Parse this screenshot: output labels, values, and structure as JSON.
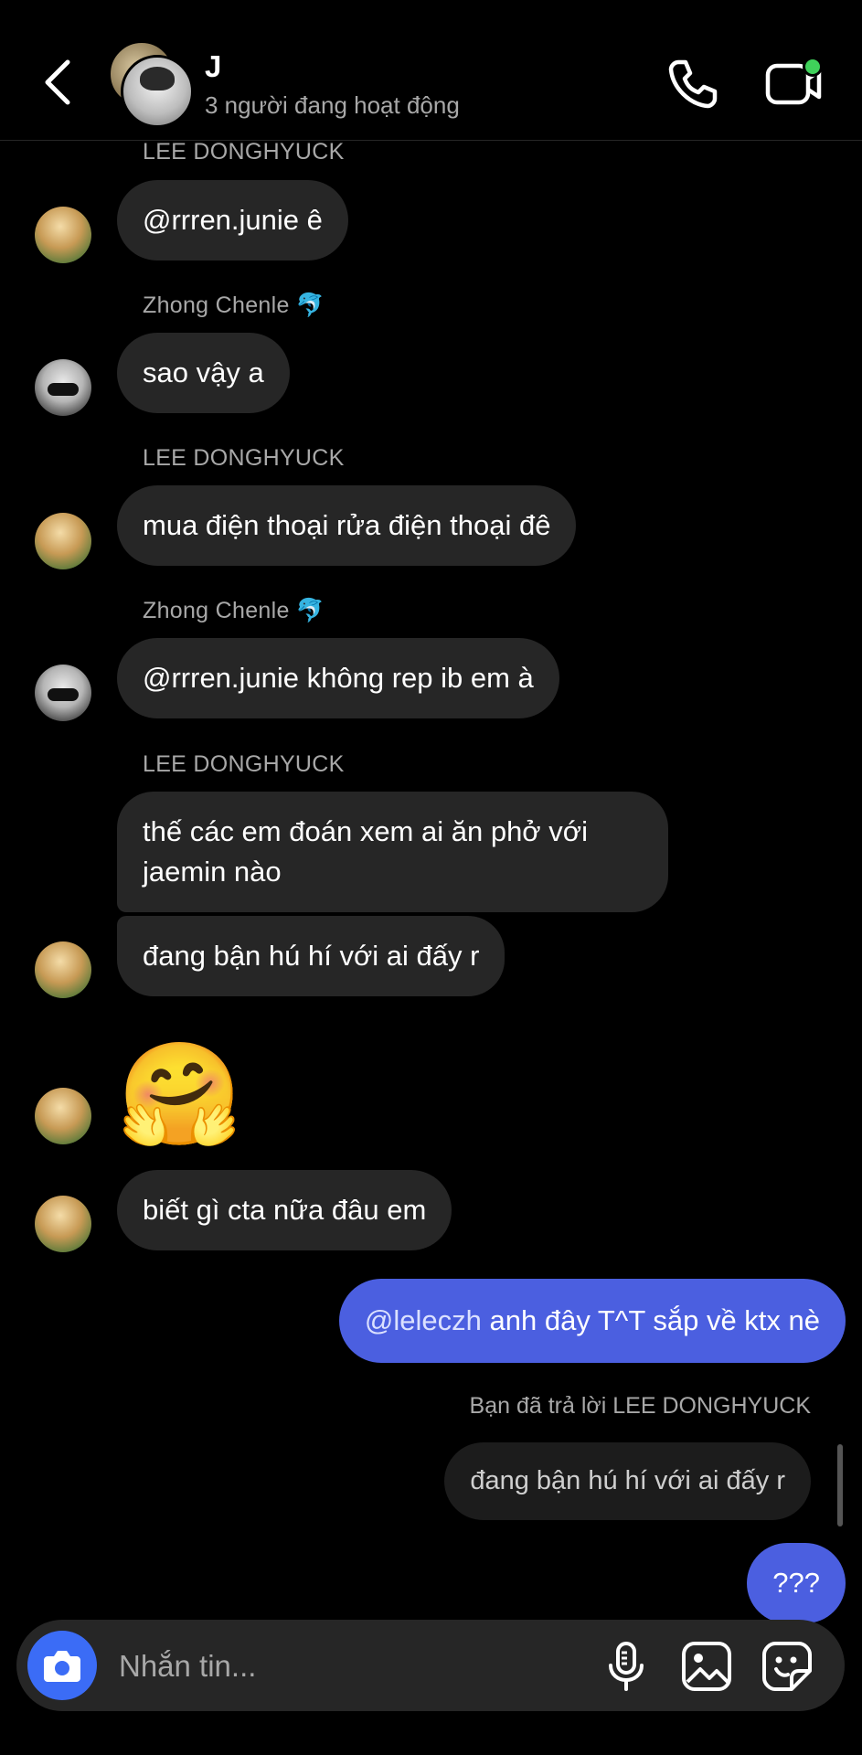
{
  "header": {
    "title": "J",
    "subtitle": "3 người đang hoạt động",
    "icons": [
      "back-arrow-icon",
      "phone-icon",
      "video-icon"
    ],
    "online_color": "#3fd15a"
  },
  "messages": [
    {
      "sender": "LEE DONGHYUCK",
      "text": "@rrren.junie ê"
    },
    {
      "sender": "Zhong Chenle 🐬",
      "text": "sao vậy a"
    },
    {
      "sender": "LEE DONGHYUCK",
      "text": "mua điện thoại rửa điện thoại đê"
    },
    {
      "sender": "Zhong Chenle 🐬",
      "text": "@rrren.junie không rep ib em à"
    },
    {
      "sender": "LEE DONGHYUCK",
      "text": "thế các em đoán xem ai ăn phở với jaemin nào"
    },
    {
      "sender": "",
      "text": "đang bận hú hí với ai đấy r"
    },
    {
      "sender": "",
      "text": "🤗"
    },
    {
      "sender": "",
      "text": "biết gì cta nữa đâu em"
    }
  ],
  "my_messages": {
    "mention": "@leleczh",
    "text": " anh đây T^T sắp về ktx nè",
    "reply_note": "Bạn đã trả lời LEE DONGHYUCK",
    "reply_quote": "đang bận hú hí với ai đấy r",
    "last": "???"
  },
  "composer": {
    "placeholder": "Nhắn tin...",
    "icons": [
      "camera-icon",
      "microphone-icon",
      "gallery-icon",
      "sticker-icon"
    ]
  },
  "colors": {
    "my_bubble": "#4b5fe0",
    "their_bubble": "#262626",
    "camera_button": "#3b6cf6"
  }
}
